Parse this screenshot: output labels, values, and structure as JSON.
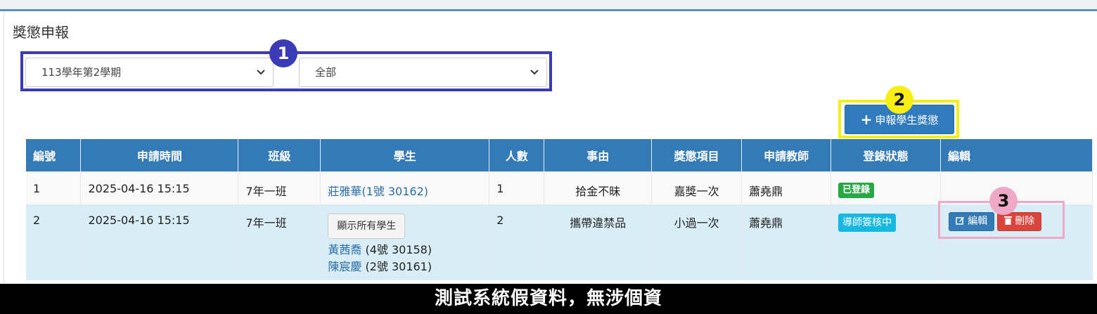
{
  "page_title": "獎懲申報",
  "filters": {
    "semester": "113學年第2學期",
    "category": "全部",
    "chevron": "⌄"
  },
  "callouts": [
    "1",
    "2",
    "3"
  ],
  "add_button": {
    "icon": "+",
    "label": "申報學生獎懲"
  },
  "table": {
    "headers": [
      "編號",
      "申請時間",
      "班級",
      "學生",
      "人數",
      "事由",
      "獎懲項目",
      "申請教師",
      "登錄狀態",
      "編輯"
    ],
    "rows": [
      {
        "id": "1",
        "time": "2025-04-16 15:15",
        "class": "7年一班",
        "student": "莊雅華(1號 30162)",
        "count": "1",
        "reason": "拾金不昧",
        "item": "嘉獎一次",
        "teacher": "蕭堯鼎",
        "status": "已登錄"
      },
      {
        "id": "2",
        "time": "2025-04-16 15:15",
        "class": "7年一班",
        "show_all": "顯示所有學生",
        "students": [
          {
            "name": "黃茜喬",
            "info": " (4號 30158)"
          },
          {
            "name": "陳宸慶",
            "info": " (2號 30161)"
          }
        ],
        "count": "2",
        "reason": "攜帶違禁品",
        "item": "小過一次",
        "teacher": "蕭堯鼎",
        "status": "導師簽核中",
        "edit_label": "編輯",
        "delete_label": "刪除"
      }
    ]
  },
  "footer": "測試系統假資料，無涉個資"
}
